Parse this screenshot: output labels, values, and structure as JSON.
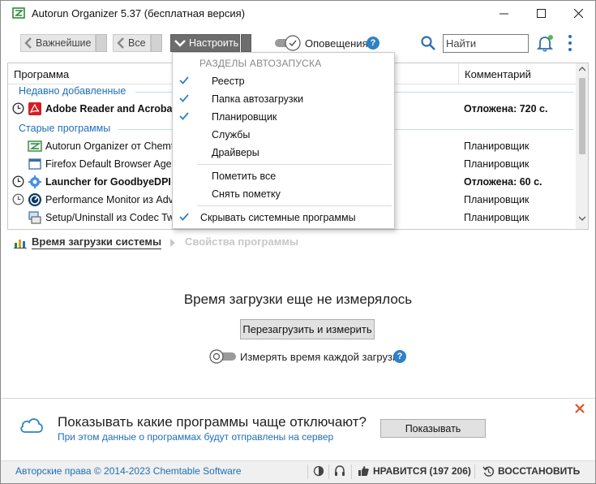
{
  "window": {
    "title": "Autorun Organizer 5.37 (бесплатная версия)",
    "icons": {
      "app": "autorun-app-icon",
      "minimize": "minimize-icon",
      "maximize": "maximize-icon",
      "close": "close-icon"
    }
  },
  "toolbar": {
    "breadcrumbs": [
      {
        "label": "Важнейшие"
      },
      {
        "label": "Все"
      },
      {
        "label": "Настроить",
        "active": true
      }
    ],
    "notifications_label": "Оповещения",
    "notifications_on": true,
    "help_glyph": "?",
    "search": {
      "placeholder": "Найти",
      "value": ""
    },
    "accent_color": "#2e82c4"
  },
  "table": {
    "columns": {
      "program": "Программа",
      "comment": "Комментарий"
    },
    "groups": [
      {
        "label": "Недавно добавленные"
      },
      {
        "label": "Старые программы"
      }
    ],
    "rows": [
      {
        "name": "Adobe Reader and Acrobat M",
        "comment": "Отложена: 720 с.",
        "bold": true,
        "delayed": true,
        "icon": "adobe-acrobat-icon"
      },
      {
        "name": "Autorun Organizer от Chemta",
        "comment": "Планировщик",
        "bold": false,
        "delayed": false,
        "icon": "autorun-organizer-icon"
      },
      {
        "name": "Firefox Default Browser Agent",
        "comment": "Планировщик",
        "bold": false,
        "delayed": false,
        "icon": "window-app-icon"
      },
      {
        "name": "Launcher for GoodbyeDPI от",
        "comment": "Отложена: 60 с.",
        "bold": true,
        "delayed": true,
        "icon": "gear-shield-icon"
      },
      {
        "name": "Performance Monitor из Adva",
        "comment": "Планировщик",
        "bold": false,
        "delayed": true,
        "icon": "performance-monitor-icon"
      },
      {
        "name": "Setup/Uninstall из Codec Twe",
        "comment": "Планировщик",
        "bold": false,
        "delayed": false,
        "icon": "setup-installer-icon"
      }
    ]
  },
  "tabs": [
    {
      "label": "Время загрузки системы",
      "active": true,
      "icon": "bar-chart-icon"
    },
    {
      "label": "Свойства программы",
      "active": false,
      "icon": "arrow-right-icon"
    }
  ],
  "boot_panel": {
    "message": "Время загрузки еще не измерялось",
    "button": "Перезагрузить и измерить",
    "measure_label": "Измерять время каждой загрузки",
    "measure_on": false
  },
  "banner": {
    "title": "Показывать какие программы чаще отключают?",
    "subtitle": "При этом данные о программах будут отправлены на сервер",
    "button": "Показывать"
  },
  "statusbar": {
    "copyright": "Авторские права © 2014-2023 Chemtable Software",
    "like": "НРАВИТСЯ (197 206)",
    "restore": "ВОССТАНОВИТЬ"
  },
  "dropdown": {
    "header": "РАЗДЕЛЫ АВТОЗАПУСКА",
    "sections": [
      {
        "label": "Реестр",
        "checked": true
      },
      {
        "label": "Папка автозагрузки",
        "checked": true
      },
      {
        "label": "Планировщик",
        "checked": true
      },
      {
        "label": "Службы",
        "checked": false
      },
      {
        "label": "Драйверы",
        "checked": false
      }
    ],
    "actions": [
      {
        "label": "Пометить все"
      },
      {
        "label": "Снять пометку"
      }
    ],
    "hide_system": {
      "label": "Скрывать системные программы",
      "checked": true
    },
    "check_color": "#2e82c4"
  }
}
